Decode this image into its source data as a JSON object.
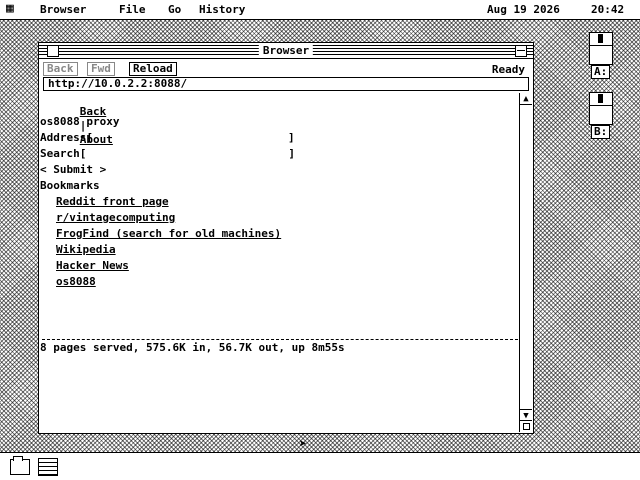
{
  "menubar": {
    "apple_glyph": "▦",
    "items": [
      "Browser",
      "File",
      "Go",
      "History"
    ],
    "date": "Aug 19 2026",
    "time": "20:42"
  },
  "window": {
    "title": "Browser",
    "toolbar": {
      "back_label": "Back",
      "fwd_label": "Fwd",
      "reload_label": "Reload",
      "status": "Ready"
    },
    "url": "http://10.0.2.2:8088/",
    "page": {
      "nav_back": "Back",
      "nav_sep": "|",
      "nav_about": "About",
      "heading": "os8088 proxy",
      "address_label": "Address[",
      "address_close": "]",
      "search_label": "Search[",
      "search_close": "]",
      "submit": "< Submit >",
      "bookmarks_label": "Bookmarks",
      "bookmarks": [
        "Reddit front page",
        "r/vintagecomputing",
        "FrogFind (search for old machines)",
        "Wikipedia",
        "Hacker News",
        "os8088"
      ],
      "footer": "8 pages served, 575.6K in, 56.7K out, up 8m55s"
    }
  },
  "desktop": {
    "drives": [
      "A:",
      "B:"
    ]
  }
}
